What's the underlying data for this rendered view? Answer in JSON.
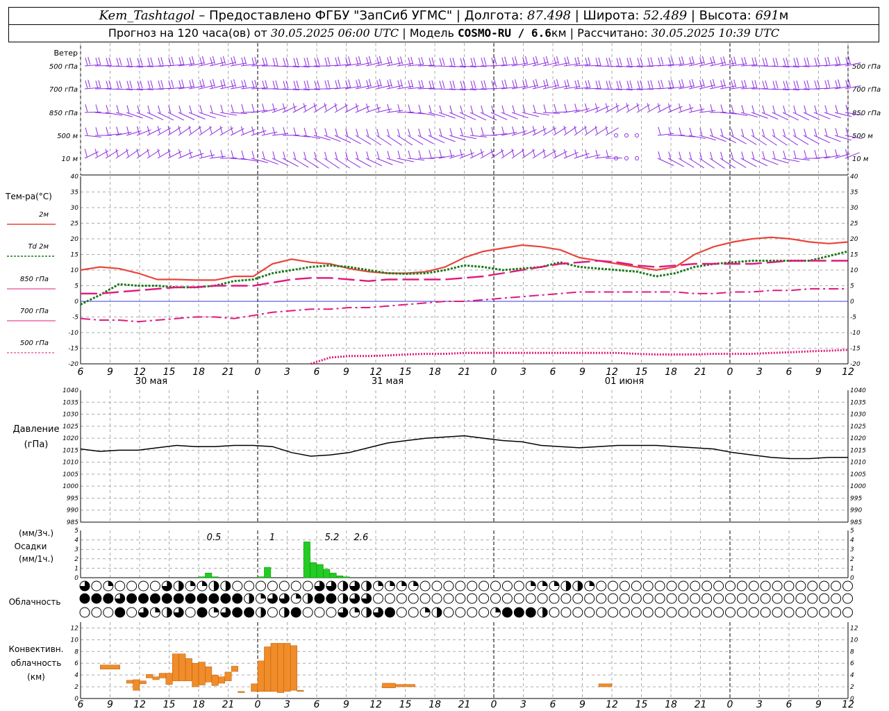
{
  "header": {
    "station": "Kem_Tashtagol",
    "provider": " – Предоставлено ФГБУ \"ЗапСиб УГМС\" | ",
    "lon_label": "Долгота: ",
    "lon": "87.498",
    "lat_label": " | Широта: ",
    "lat": "52.489",
    "alt_label": " | Высота: ",
    "alt": "691",
    "alt_unit": "м",
    "forecast_prefix": "Прогноз на 120 часа(ов) от ",
    "forecast_start": "30.05.2025 06:00 UTC",
    "model_label": " | Модель ",
    "model": "COSMO-RU / 6.6",
    "model_unit": "км",
    "computed_label": " | Рассчитано: ",
    "computed": "30.05.2025 10:39 UTC"
  },
  "x_ticks": [
    "6",
    "9",
    "12",
    "15",
    "18",
    "21",
    "0",
    "3",
    "6",
    "9",
    "12",
    "15",
    "18",
    "21",
    "0",
    "3",
    "6",
    "9",
    "12",
    "15",
    "18",
    "21",
    "0",
    "3",
    "6",
    "9",
    "12"
  ],
  "dates": [
    "30 мая",
    "31 мая",
    "01 июня"
  ],
  "wind": {
    "title": "Ветер",
    "levels": [
      "500 гПа",
      "700 гПа",
      "850 гПа",
      "500 м",
      "10   м"
    ],
    "color": "#8a2be2"
  },
  "temperature": {
    "title": "Тем-ра(°C)",
    "legend": [
      {
        "label": "2м",
        "color": "#e8453c"
      },
      {
        "label": "Td  2м",
        "color": "#1a7a1a"
      },
      {
        "label": "850 гПа",
        "color": "#e0197d"
      },
      {
        "label": "700 гПа",
        "color": "#e0197d"
      },
      {
        "label": "500 гПа",
        "color": "#e0197d"
      }
    ],
    "y_ticks": [
      "40",
      "35",
      "30",
      "25",
      "20",
      "15",
      "10",
      "5",
      "0",
      "-5",
      "-10",
      "-15",
      "-20"
    ]
  },
  "pressure": {
    "title": "Давление",
    "unit": "(гПа)",
    "y_ticks": [
      "1040",
      "1035",
      "1030",
      "1025",
      "1020",
      "1015",
      "1010",
      "1005",
      "1000",
      "995",
      "990",
      "985"
    ]
  },
  "precip": {
    "unit3": "(мм/3ч.)",
    "title": "Осадки",
    "unit1": "(мм/1ч.)",
    "y_ticks": [
      "5",
      "4",
      "3",
      "2",
      "1",
      "0"
    ],
    "labels": [
      "0.5",
      "1",
      "5.2",
      "2.6"
    ],
    "color": "#22cc22"
  },
  "cloud": {
    "title": "Облачность"
  },
  "convective": {
    "title1": "Конвективн.",
    "title2": "облачность",
    "unit": "(км)",
    "y_ticks": [
      "12",
      "10",
      "8",
      "6",
      "4",
      "2",
      "0"
    ],
    "color": "#f08c2a"
  },
  "chart_data": [
    {
      "type": "line",
      "title": "Тем-ра(°C)",
      "x_hours": [
        0,
        3,
        6,
        9,
        12,
        15,
        18,
        21,
        24,
        27,
        30,
        33,
        36,
        39,
        42,
        45,
        48,
        51,
        54,
        57,
        60,
        63,
        66,
        69,
        72,
        75,
        78,
        81,
        84,
        87,
        90,
        93,
        96,
        99,
        102,
        105,
        108,
        111,
        114,
        117,
        120
      ],
      "ylim": [
        -20,
        40
      ],
      "series": [
        {
          "name": "2м",
          "values": [
            10,
            11,
            10.5,
            9,
            7,
            7,
            6.8,
            6.8,
            8,
            8,
            12,
            13.5,
            12.5,
            12,
            10.5,
            9.5,
            9,
            9,
            9.5,
            11,
            14,
            16,
            17,
            18,
            17.5,
            16.5,
            14,
            13,
            12,
            11,
            10,
            11,
            15,
            17.5,
            19,
            20,
            20.5,
            20,
            19,
            18.5,
            19
          ]
        },
        {
          "name": "Td  2м",
          "values": [
            -1,
            2,
            5.5,
            5,
            5,
            4.5,
            4.5,
            5,
            6.5,
            7,
            9,
            10,
            11,
            11.5,
            11,
            10,
            9,
            8.8,
            9,
            10,
            11.5,
            11,
            10,
            10.5,
            11,
            12.5,
            11,
            10.5,
            10,
            9.5,
            8,
            9,
            11,
            12,
            12.5,
            13,
            13,
            13,
            13,
            14.5,
            16
          ]
        },
        {
          "name": "850 гПа",
          "values": [
            2.5,
            2.5,
            3,
            3.5,
            4,
            4.5,
            4.5,
            5,
            5,
            5,
            6,
            7,
            7.5,
            7.5,
            7,
            6.5,
            7,
            7,
            7,
            7,
            7.5,
            8,
            9,
            10,
            11,
            12,
            12.5,
            13,
            12.5,
            11.5,
            11,
            11.5,
            12,
            12,
            12,
            12,
            12.5,
            13,
            13,
            13,
            13
          ]
        },
        {
          "name": "700 гПа",
          "values": [
            -5.5,
            -6,
            -6,
            -6.5,
            -6,
            -5.5,
            -5,
            -5,
            -5.5,
            -4.5,
            -3.5,
            -3,
            -2.5,
            -2.5,
            -2,
            -2,
            -1.5,
            -1,
            -0.5,
            0,
            0,
            0.5,
            1,
            1.5,
            2,
            2.5,
            3,
            3,
            3,
            3,
            3,
            3,
            2.5,
            2.5,
            3,
            3,
            3.5,
            3.5,
            4,
            4,
            4
          ]
        },
        {
          "name": "500 гПа",
          "values": [
            null,
            null,
            null,
            null,
            null,
            null,
            null,
            null,
            null,
            null,
            null,
            null,
            -20,
            -18,
            -17.5,
            -17.5,
            -17.3,
            -17,
            -16.8,
            -16.8,
            -16.5,
            -16.5,
            -16.5,
            -16.5,
            -16.5,
            -16.5,
            -16.5,
            -16.5,
            -16.5,
            -16.8,
            -17,
            -17,
            -17,
            -16.8,
            -16.8,
            -16.8,
            -16.5,
            -16.3,
            -16,
            -15.8,
            -15.5
          ]
        }
      ]
    },
    {
      "type": "line",
      "title": "Давление",
      "ylim": [
        985,
        1040
      ],
      "x_hours": [
        0,
        3,
        6,
        9,
        12,
        15,
        18,
        21,
        24,
        27,
        30,
        33,
        36,
        39,
        42,
        45,
        48,
        51,
        54,
        57,
        60,
        63,
        66,
        69,
        72,
        75,
        78,
        81,
        84,
        87,
        90,
        93,
        96,
        99,
        102,
        105,
        108,
        111,
        114,
        117,
        120
      ],
      "series": [
        {
          "name": "",
          "values": [
            1015.5,
            1014.5,
            1015,
            1015,
            1016,
            1017,
            1016.5,
            1016.5,
            1017,
            1017,
            1016.5,
            1014,
            1012.5,
            1013,
            1014,
            1016,
            1018,
            1019,
            1020,
            1020.5,
            1021,
            1020,
            1019,
            1018.5,
            1017,
            1016.5,
            1016,
            1016.5,
            1017,
            1017,
            1017,
            1016.5,
            1016,
            1015.5,
            1014,
            1013,
            1012,
            1011.5,
            1011.5,
            1012,
            1012
          ]
        }
      ]
    },
    {
      "type": "bar",
      "title": "Осадки",
      "ylim": [
        0,
        5
      ],
      "x_hours": [
        17,
        18,
        19,
        20,
        21,
        22,
        23,
        24,
        25,
        26,
        27,
        28,
        29,
        30,
        31,
        32,
        33,
        34,
        35,
        36,
        37,
        38,
        39,
        40,
        41,
        42,
        43,
        44
      ],
      "values": [
        0,
        0.1,
        0.5,
        0.1,
        0,
        0,
        0,
        0,
        0,
        0,
        0.1,
        1.1,
        0,
        0,
        0,
        0,
        0,
        3.8,
        1.6,
        1.4,
        0.9,
        0.5,
        0.2,
        0.1,
        0,
        0,
        0,
        0
      ]
    },
    {
      "type": "bar",
      "title": "Конвективн. облачность",
      "ylim": [
        0,
        13
      ],
      "segments": [
        {
          "x0": 3,
          "x1": 6,
          "base": 5,
          "top": 5.7
        },
        {
          "x0": 7,
          "x1": 8,
          "base": 2.6,
          "top": 3.1
        },
        {
          "x0": 8,
          "x1": 9,
          "base": 1.4,
          "top": 3.2
        },
        {
          "x0": 9,
          "x1": 10,
          "base": 2.5,
          "top": 3
        },
        {
          "x0": 10,
          "x1": 11,
          "base": 3.5,
          "top": 4.1
        },
        {
          "x0": 11,
          "x1": 12,
          "base": 3.2,
          "top": 3.7
        },
        {
          "x0": 12,
          "x1": 13,
          "base": 3.5,
          "top": 4.3
        },
        {
          "x0": 13,
          "x1": 14,
          "base": 2.4,
          "top": 4.3
        },
        {
          "x0": 14,
          "x1": 15,
          "base": 3,
          "top": 7.6
        },
        {
          "x0": 15,
          "x1": 16,
          "base": 3,
          "top": 7.6
        },
        {
          "x0": 16,
          "x1": 17,
          "base": 3,
          "top": 6.8
        },
        {
          "x0": 17,
          "x1": 18,
          "base": 2,
          "top": 6
        },
        {
          "x0": 18,
          "x1": 19,
          "base": 2.3,
          "top": 6.2
        },
        {
          "x0": 19,
          "x1": 20,
          "base": 2.8,
          "top": 5.4
        },
        {
          "x0": 20,
          "x1": 21,
          "base": 2.2,
          "top": 4
        },
        {
          "x0": 21,
          "x1": 22,
          "base": 2.6,
          "top": 3.7
        },
        {
          "x0": 22,
          "x1": 23,
          "base": 3,
          "top": 4.5
        },
        {
          "x0": 23,
          "x1": 24,
          "base": 4.6,
          "top": 5.5
        },
        {
          "x0": 24,
          "x1": 25,
          "base": 1,
          "top": 1.2
        },
        {
          "x0": 26,
          "x1": 27,
          "base": 1.2,
          "top": 2.5
        },
        {
          "x0": 27,
          "x1": 28,
          "base": 1.2,
          "top": 6.4
        },
        {
          "x0": 28,
          "x1": 29,
          "base": 1.2,
          "top": 8.8
        },
        {
          "x0": 29,
          "x1": 30,
          "base": 1.2,
          "top": 9.4
        },
        {
          "x0": 30,
          "x1": 31,
          "base": 1,
          "top": 9.4
        },
        {
          "x0": 31,
          "x1": 32,
          "base": 1.2,
          "top": 9.4
        },
        {
          "x0": 32,
          "x1": 33,
          "base": 1.4,
          "top": 9
        },
        {
          "x0": 33,
          "x1": 34,
          "base": 1.2,
          "top": 1.4
        },
        {
          "x0": 46,
          "x1": 48,
          "base": 1.8,
          "top": 2.6
        },
        {
          "x0": 48,
          "x1": 51,
          "base": 2,
          "top": 2.4
        },
        {
          "x0": 79,
          "x1": 81,
          "base": 2,
          "top": 2.5
        }
      ]
    }
  ]
}
